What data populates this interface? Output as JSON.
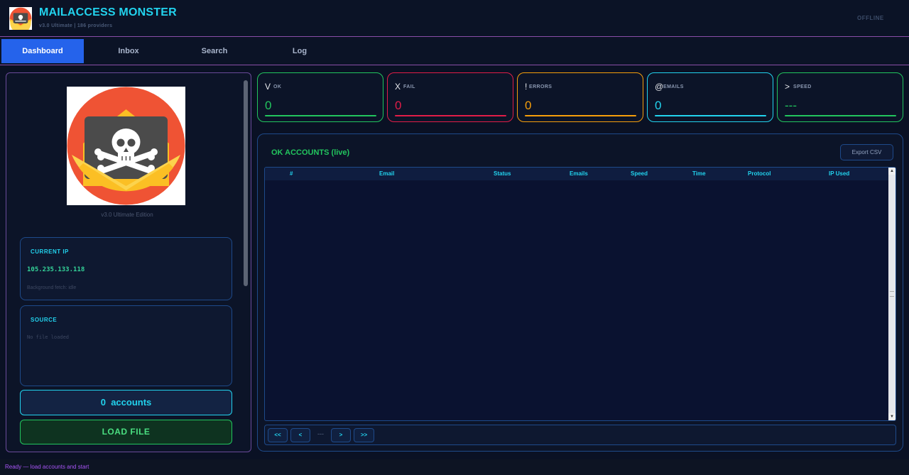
{
  "header": {
    "title": "MAILACCESS MONSTER",
    "subtitle": "v3.0 Ultimate | 186 providers",
    "status": "OFFLINE"
  },
  "tabs": [
    {
      "label": "Dashboard",
      "active": true
    },
    {
      "label": "Inbox",
      "active": false
    },
    {
      "label": "Search",
      "active": false
    },
    {
      "label": "Log",
      "active": false
    }
  ],
  "sidebar": {
    "logo_icon": "skull-envelope-icon",
    "edition": "v3.0  Ultimate Edition",
    "current_ip": {
      "label": "CURRENT IP",
      "value": "105.235.133.118",
      "fetch_status": "Background fetch: idle"
    },
    "source": {
      "label": "SOURCE",
      "value": "No file loaded"
    },
    "accounts_count": "0",
    "accounts_label": "accounts",
    "load_button": "LOAD FILE"
  },
  "stats": [
    {
      "icon": "V",
      "label": "OK",
      "value": "0",
      "color": "#22c55e"
    },
    {
      "icon": "X",
      "label": "FAIL",
      "value": "0",
      "color": "#e11d48"
    },
    {
      "icon": "!",
      "label": "ERRORS",
      "value": "0",
      "color": "#f59e0b"
    },
    {
      "icon": "@",
      "label": "EMAILS",
      "value": "0",
      "color": "#22d3ee"
    },
    {
      "icon": ">",
      "label": "SPEED",
      "value": "---",
      "color": "#22c55e"
    }
  ],
  "ok_accounts": {
    "title": "OK ACCOUNTS (live)",
    "export_label": "Export CSV",
    "columns": [
      "#",
      "Email",
      "Status",
      "Emails",
      "Speed",
      "Time",
      "Protocol",
      "IP Used"
    ],
    "rows": []
  },
  "pager": {
    "first": "<<",
    "prev": "<",
    "info": "---",
    "next": ">",
    "last": ">>"
  },
  "footer": {
    "status": "Ready — load accounts and start"
  },
  "colors": {
    "accent": "#22d3ee",
    "active_tab": "#2563eb",
    "ok": "#22c55e",
    "border": "#8a4ea8"
  }
}
